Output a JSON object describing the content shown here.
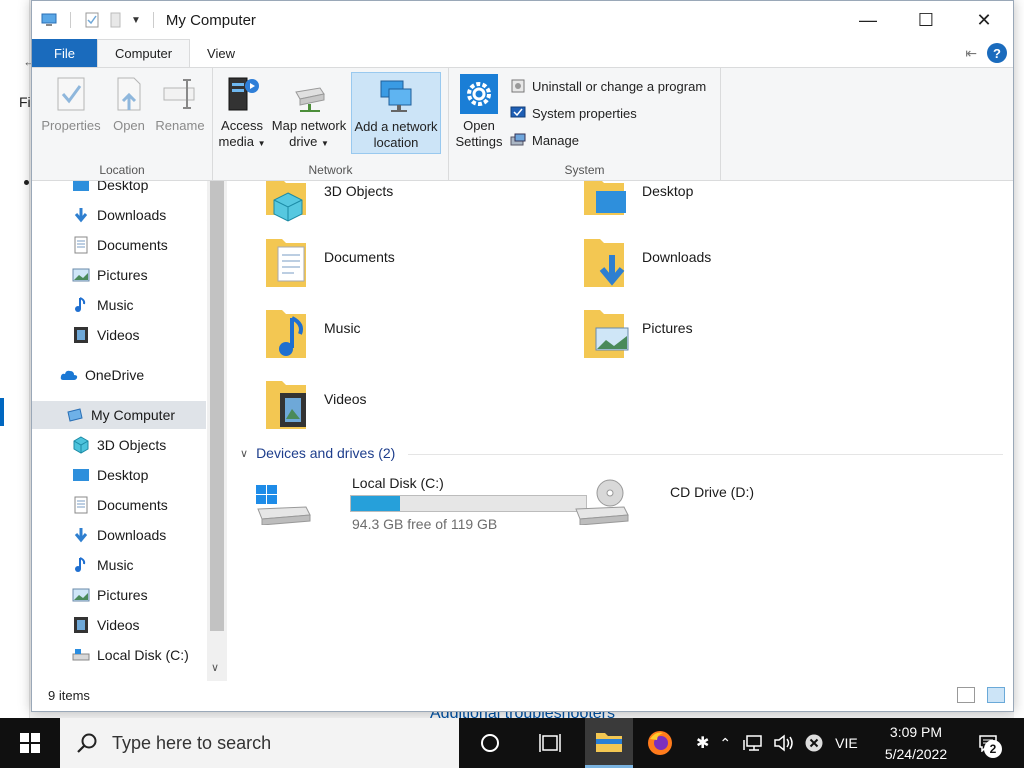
{
  "window": {
    "title": "My Computer"
  },
  "tabs": {
    "file": "File",
    "computer": "Computer",
    "view": "View"
  },
  "ribbon": {
    "location": {
      "label": "Location",
      "properties": "Properties",
      "open": "Open",
      "rename": "Rename"
    },
    "network": {
      "label": "Network",
      "access_media_1": "Access",
      "access_media_2": "media",
      "map_drive_1": "Map network",
      "map_drive_2": "drive",
      "add_location_1": "Add a network",
      "add_location_2": "location"
    },
    "system": {
      "label": "System",
      "open_settings_1": "Open",
      "open_settings_2": "Settings",
      "uninstall": "Uninstall or change a program",
      "system_properties": "System properties",
      "manage": "Manage"
    }
  },
  "nav": {
    "quick_access": [
      {
        "label": "Desktop",
        "icon": "desktop-icon",
        "pinned": true
      },
      {
        "label": "Downloads",
        "icon": "downloads-icon",
        "pinned": true
      },
      {
        "label": "Documents",
        "icon": "documents-icon",
        "pinned": true
      },
      {
        "label": "Pictures",
        "icon": "pictures-icon",
        "pinned": true
      },
      {
        "label": "Music",
        "icon": "music-icon",
        "pinned": false
      },
      {
        "label": "Videos",
        "icon": "videos-icon",
        "pinned": false
      }
    ],
    "onedrive": "OneDrive",
    "my_computer": "My Computer",
    "computer_items": [
      {
        "label": "3D Objects",
        "icon": "3d-objects-icon"
      },
      {
        "label": "Desktop",
        "icon": "desktop-icon"
      },
      {
        "label": "Documents",
        "icon": "documents-icon"
      },
      {
        "label": "Downloads",
        "icon": "downloads-icon"
      },
      {
        "label": "Music",
        "icon": "music-icon"
      },
      {
        "label": "Pictures",
        "icon": "pictures-icon"
      },
      {
        "label": "Videos",
        "icon": "videos-icon"
      },
      {
        "label": "Local Disk (C:)",
        "icon": "drive-icon"
      }
    ]
  },
  "content": {
    "folders": [
      {
        "label": "3D Objects"
      },
      {
        "label": "Desktop"
      },
      {
        "label": "Documents"
      },
      {
        "label": "Downloads"
      },
      {
        "label": "Music"
      },
      {
        "label": "Pictures"
      },
      {
        "label": "Videos"
      }
    ],
    "devices_header": "Devices and drives (2)",
    "drives": [
      {
        "label": "Local Disk (C:)",
        "free": "94.3 GB free of 119 GB",
        "used_fraction": 0.21
      },
      {
        "label": "CD Drive (D:)"
      }
    ]
  },
  "status": {
    "items": "9 items"
  },
  "background": {
    "fi": "Fi",
    "link": "Additional troubleshooters"
  },
  "taskbar": {
    "search_placeholder": "Type here to search",
    "language": "VIE",
    "time": "3:09 PM",
    "date": "5/24/2022",
    "notifications": "2"
  },
  "colors": {
    "accent": "#1a6bbd",
    "drive_fill": "#26a0da",
    "folder": "#f8d775"
  }
}
